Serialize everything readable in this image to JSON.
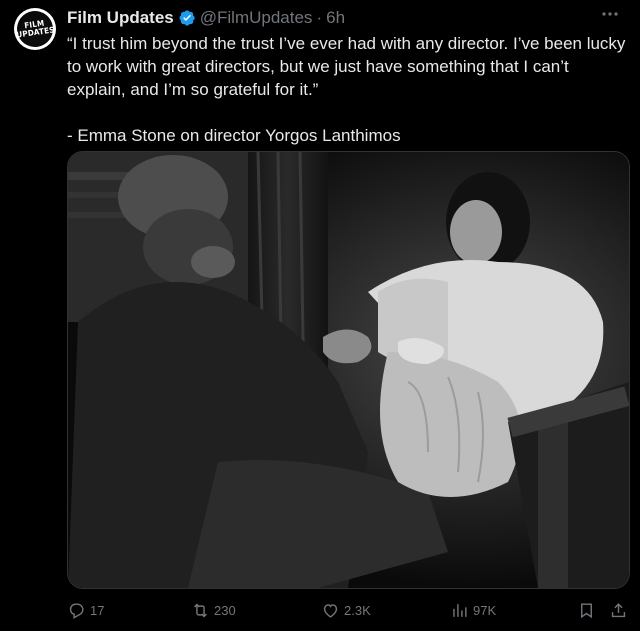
{
  "tweet": {
    "avatar": {
      "line1": "FILM",
      "line2": "UPDATES"
    },
    "author": {
      "name": "Film Updates",
      "handle": "@FilmUpdates",
      "separator": "·",
      "time": "6h",
      "verified_icon": "verified-badge-icon"
    },
    "more_icon": "more-dots-icon",
    "text": {
      "line1": "“I trust him beyond the trust I’ve ever had with any director. I’ve been lucky",
      "line2": "to work with great directors, but we just have something that I can’t",
      "line3": "explain, and I’m so grateful for it.”",
      "line4": "- Emma Stone on director Yorgos Lanthimos"
    },
    "actions": {
      "reply": {
        "icon": "reply-icon",
        "count": "17"
      },
      "retweet": {
        "icon": "retweet-icon",
        "count": "230"
      },
      "like": {
        "icon": "heart-icon",
        "count": "2.3K"
      },
      "views": {
        "icon": "views-icon",
        "count": "97K"
      },
      "bookmark": {
        "icon": "bookmark-icon"
      },
      "share": {
        "icon": "share-icon"
      }
    }
  },
  "colors": {
    "background": "#000000",
    "text": "#e7e9ea",
    "muted": "#71767b",
    "verified": "#1d9bf0",
    "border": "#2f3336"
  }
}
